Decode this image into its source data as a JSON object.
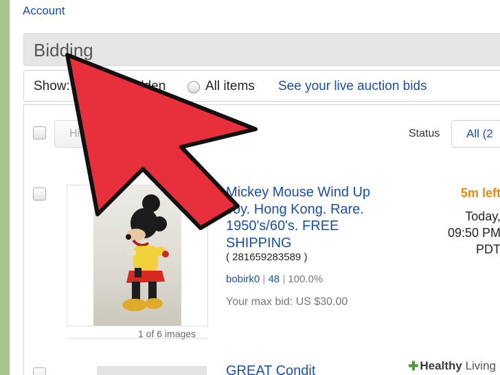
{
  "header": {
    "account_link": "Account"
  },
  "section": {
    "title": "Bidding"
  },
  "filter_bar": {
    "show_label": "Show:",
    "hidden_option_fragment": "dden",
    "all_items_label": "All items",
    "live_auction_link": "See your live auction bids"
  },
  "list_toolbar": {
    "hide_button": "Hide",
    "status_label": "Status",
    "status_filter": "All (2"
  },
  "items": [
    {
      "title": "Mickey Mouse Wind Up Toy. Hong Kong. Rare. 1950's/60's. FREE SHIPPING",
      "item_id": "( 281659283589 )",
      "seller_name": "bobirk0",
      "seller_feedback": "48",
      "seller_positive": "100.0%",
      "max_bid": "Your max bid: US $30.00",
      "time_left": "5m left",
      "end_time": "Today,\n09:50 PM\nPDT",
      "image_count": "1 of 6 images"
    },
    {
      "title": "GREAT Condit"
    }
  ],
  "watermark": {
    "brand_bold": "Healthy",
    "brand_rest": "Living"
  },
  "colors": {
    "link": "#1a4ea8",
    "time_left": "#e58a14",
    "overlay_arrow": "#e8303d",
    "page_border": "#a8c38b"
  }
}
